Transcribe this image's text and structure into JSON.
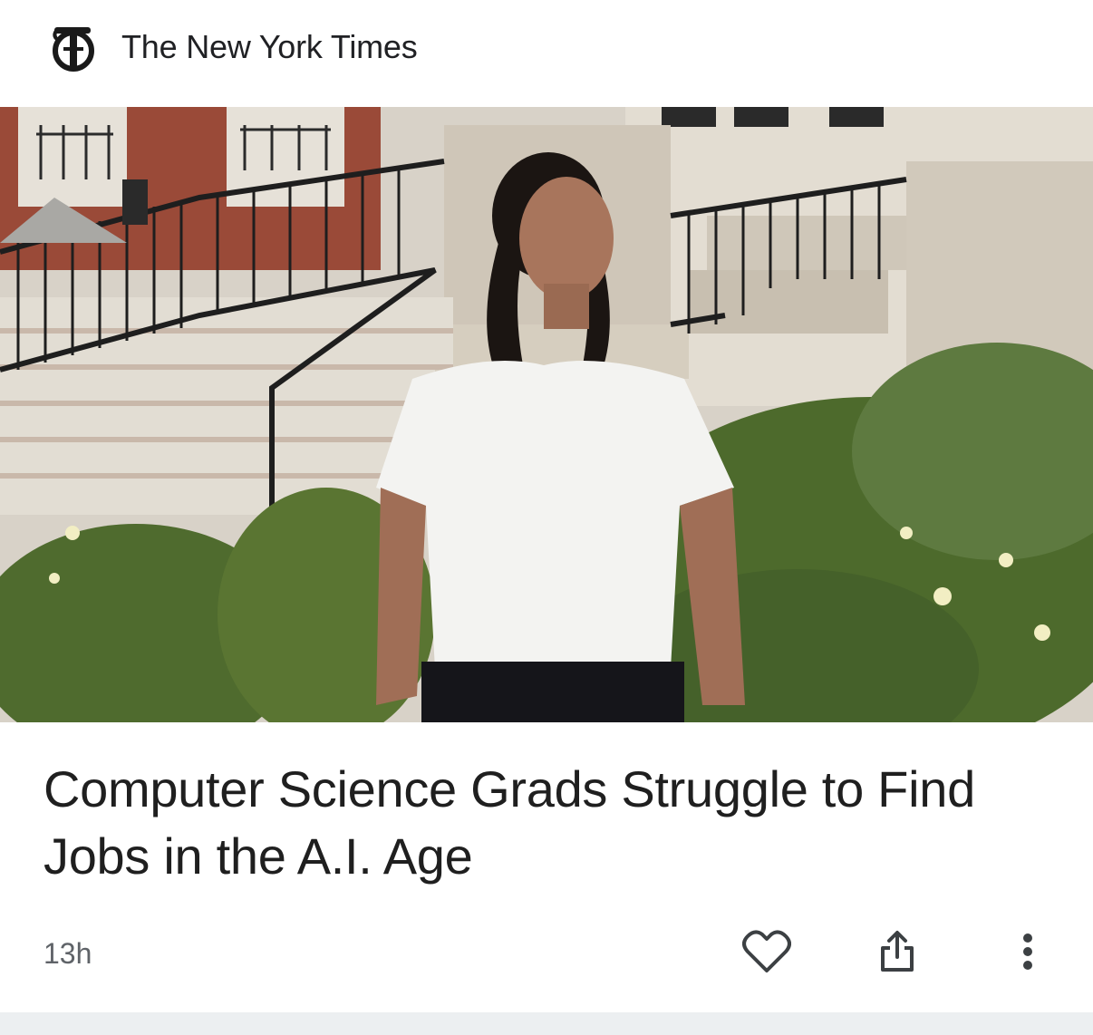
{
  "card": {
    "source": {
      "logo_icon": "nyt-logo-icon",
      "name": "The New York Times"
    },
    "headline": "Computer Science Grads Struggle to Find Jobs in the A.I. Age",
    "time": "13h",
    "actions": {
      "like_icon": "heart-outline-icon",
      "share_icon": "share-icon",
      "more_icon": "more-vert-icon"
    }
  },
  "colors": {
    "text_primary": "#1f1f1f",
    "text_secondary": "#5f6368",
    "divider": "#eceff1"
  }
}
